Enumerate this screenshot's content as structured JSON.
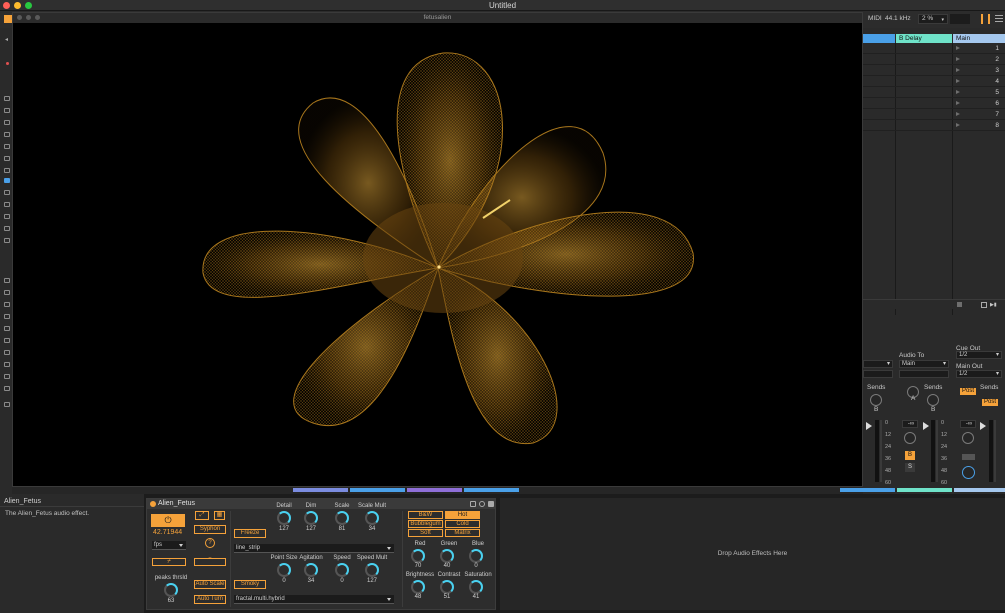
{
  "app": {
    "title": "Untitled",
    "video_window_title": "fetusalien"
  },
  "toolbar": {
    "midi_label": "MIDI",
    "sample_rate": "44.1 kHz",
    "cpu_load": "2 %"
  },
  "mixer": {
    "tracks": [
      {
        "name": "",
        "color": "#4aa0e8"
      },
      {
        "name": "B Delay",
        "color": "#6fe3c9"
      },
      {
        "name": "Main",
        "color": "#a5c8ee"
      }
    ],
    "scene_numbers": [
      "1",
      "2",
      "3",
      "4",
      "5",
      "6",
      "7",
      "8"
    ],
    "audio_to_label": "Audio To",
    "audio_to_value": "Main",
    "cue_out_label": "Cue Out",
    "cue_out_value": "1/2",
    "main_out_label": "Main Out",
    "main_out_value": "1/2",
    "sends_label": "Sends",
    "post_label": "Post",
    "send_a_label": "A",
    "send_b_label": "B",
    "volume_readout": "-∞",
    "meter_ticks": [
      "0",
      "12",
      "24",
      "36",
      "48",
      "60"
    ],
    "track_b_activator": "B",
    "solo_label": "S",
    "cue_label": "⊙"
  },
  "device_info": {
    "title": "Alien_Fetus",
    "description": "The Alien_Fetus audio effect."
  },
  "device": {
    "name": "Alien_Fetus",
    "fps_value": "42.71944",
    "fps_unit": "fps",
    "help_label": "?",
    "syphon_label": "Syphon",
    "freeze_label": "Freeze",
    "auto_scale_label": "Auto Scale",
    "auto_turn_label": "Auto Turn",
    "smoky_label": "Smoky",
    "peaks_label": "peaks thrsld",
    "peaks_value": "63",
    "draw_mode": "line_strip",
    "fractal_mode": "fractal.multi.hybrid",
    "params_top": [
      {
        "label": "Detail",
        "value": "127"
      },
      {
        "label": "Dim",
        "value": "127"
      },
      {
        "label": "Scale",
        "value": "81"
      },
      {
        "label": "Scale Mult",
        "value": "34"
      }
    ],
    "params_bottom": [
      {
        "label": "Point Size",
        "value": "0"
      },
      {
        "label": "Agitation",
        "value": "34"
      },
      {
        "label": "Speed",
        "value": "0"
      },
      {
        "label": "Speed Mult",
        "value": "127"
      }
    ],
    "color_modes": [
      "B&W",
      "Hot",
      "Bubblegum",
      "Cold",
      "Soft",
      "Matrix"
    ],
    "color_mode_selected": "Hot",
    "color_params": [
      {
        "label": "Red",
        "value": "70"
      },
      {
        "label": "Green",
        "value": "40"
      },
      {
        "label": "Blue",
        "value": "0"
      },
      {
        "label": "Brightness",
        "value": "48"
      },
      {
        "label": "Contrast",
        "value": "51"
      },
      {
        "label": "Saturation",
        "value": "41"
      }
    ],
    "accent_color": "#f5a23a",
    "knob_color": "#4ad1f0"
  },
  "dropzone": {
    "text": "Drop Audio Effects Here"
  }
}
